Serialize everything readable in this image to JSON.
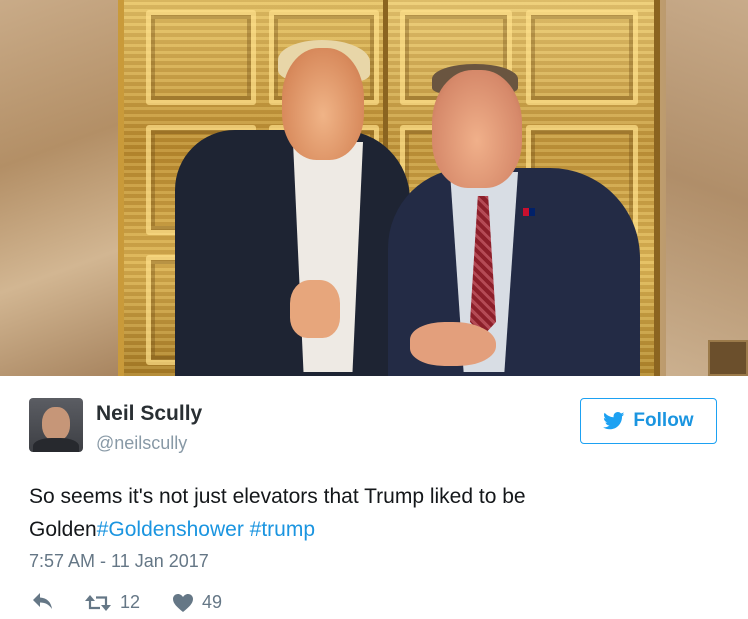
{
  "photo": {
    "description_icon": "photo-image"
  },
  "user": {
    "name": "Neil Scully",
    "handle": "@neilscully"
  },
  "follow_button": {
    "label": "Follow",
    "icon": "twitter-bird-icon",
    "color": "#1b95e0"
  },
  "tweet": {
    "text_part1": "So seems it's not just elevators that Trump liked to be Golden",
    "hashtag1": "#Goldenshower",
    "hashtag2": "#trump",
    "timestamp": "7:57 AM - 11 Jan 2017"
  },
  "actions": {
    "reply_icon": "reply-icon",
    "retweet_icon": "retweet-icon",
    "retweet_count": "12",
    "like_icon": "heart-icon",
    "like_count": "49"
  },
  "colors": {
    "link": "#1b95e0",
    "muted": "#657786",
    "text": "#14171a"
  }
}
